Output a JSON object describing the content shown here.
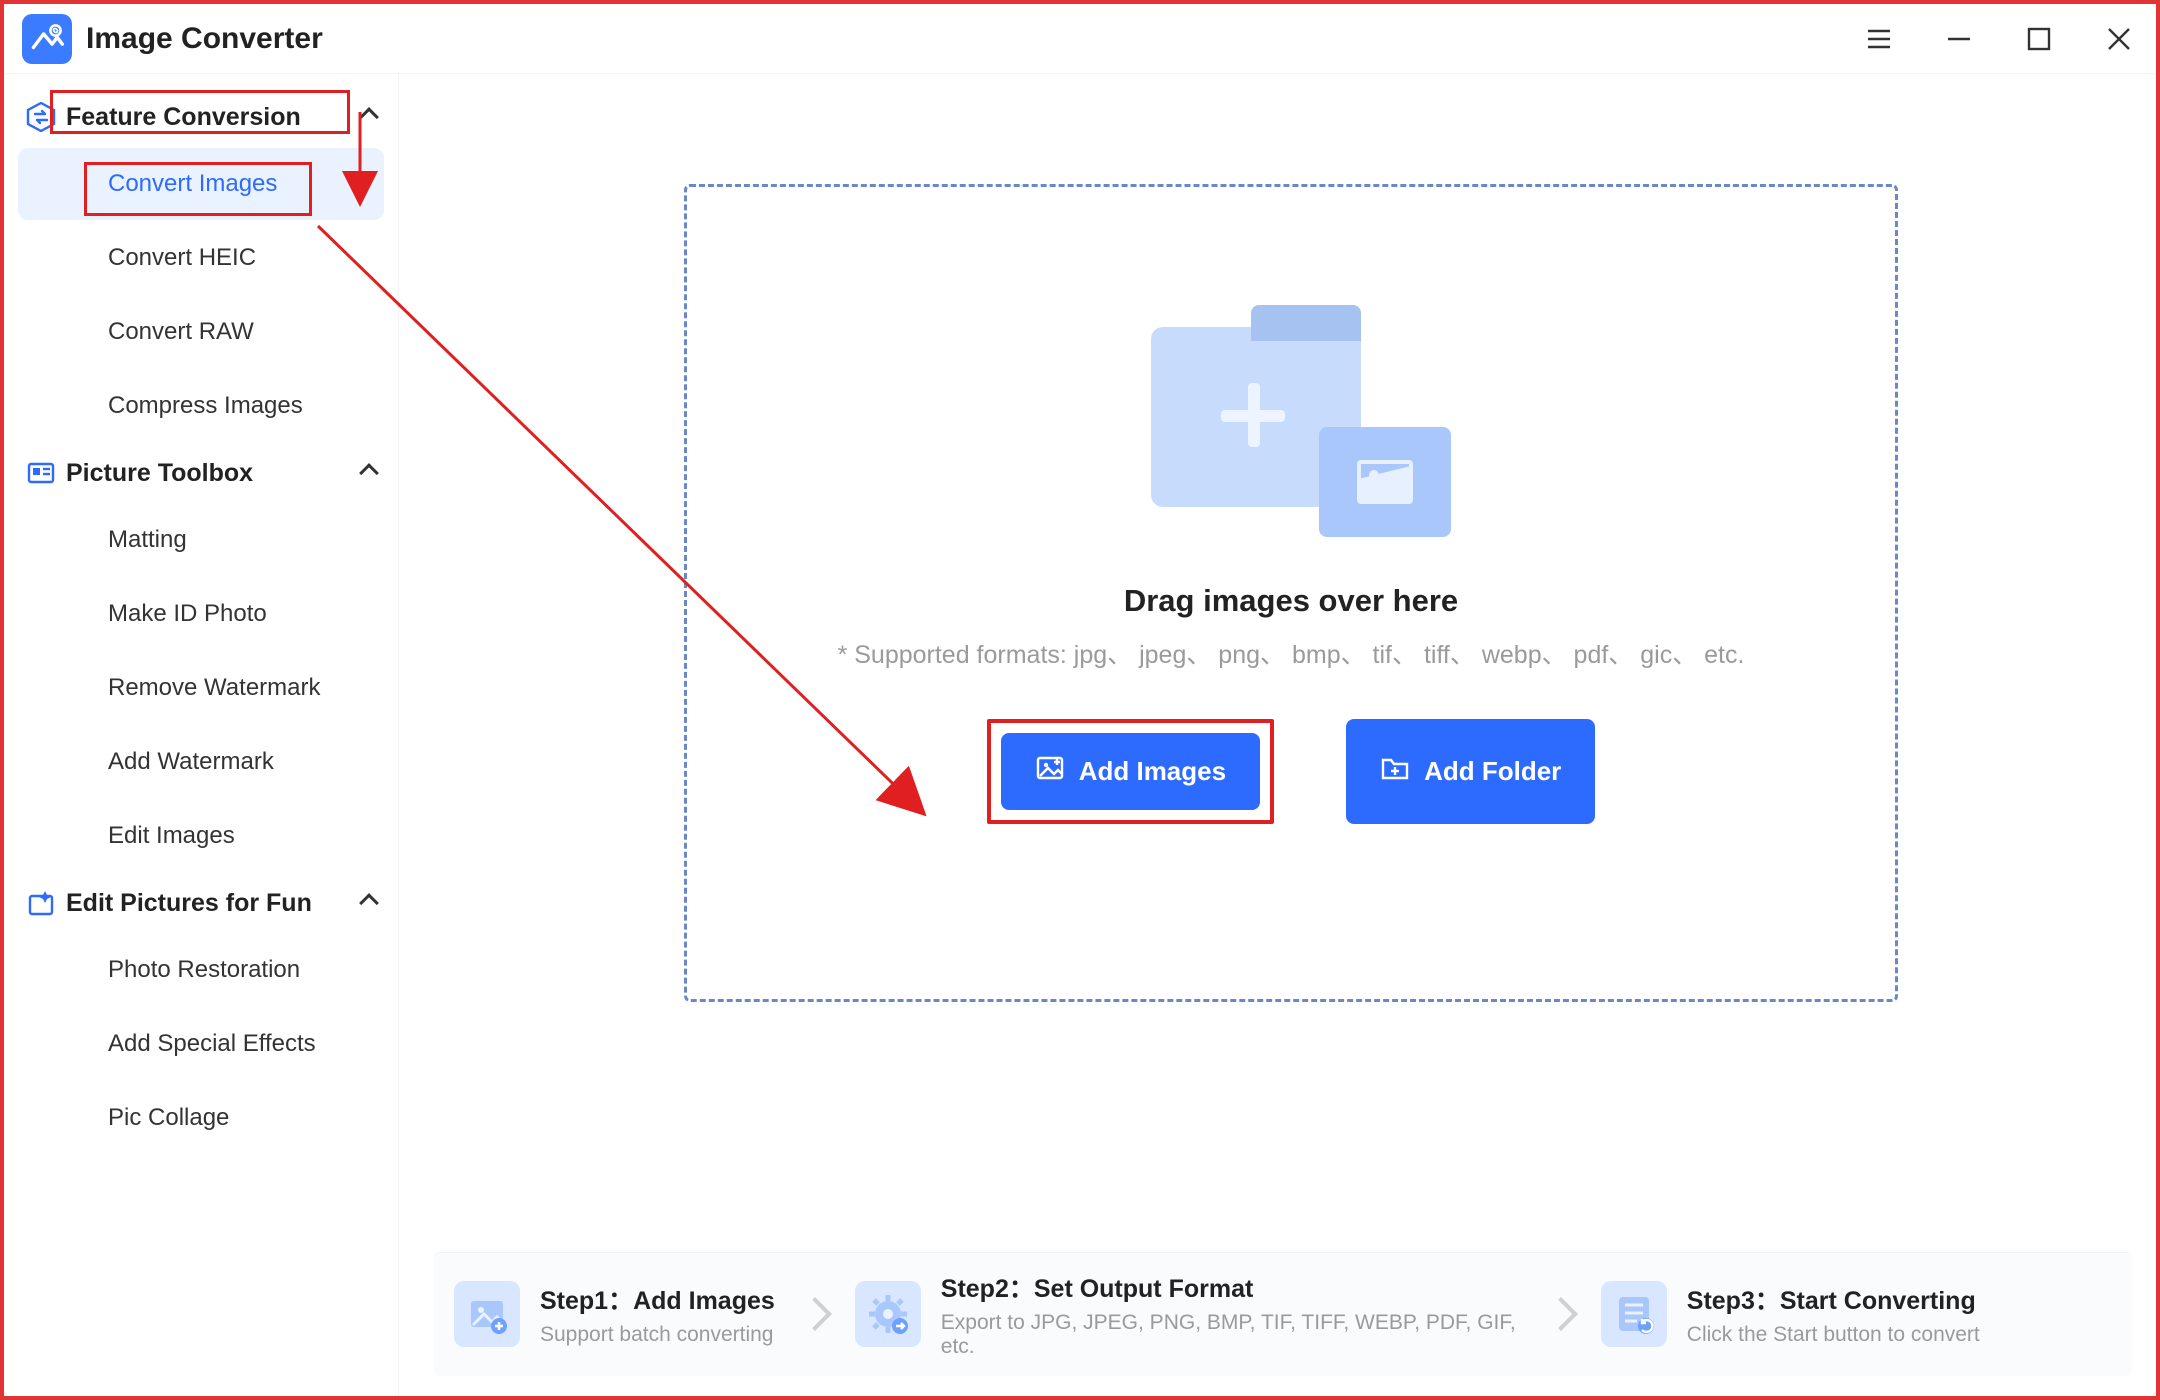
{
  "app": {
    "title": "Image Converter"
  },
  "sidebar": {
    "sections": [
      {
        "title": "Feature Conversion",
        "items": [
          "Convert Images",
          "Convert HEIC",
          "Convert RAW",
          "Compress Images"
        ]
      },
      {
        "title": "Picture Toolbox",
        "items": [
          "Matting",
          "Make ID Photo",
          "Remove Watermark",
          "Add Watermark",
          "Edit Images"
        ]
      },
      {
        "title": "Edit Pictures for Fun",
        "items": [
          "Photo Restoration",
          "Add Special Effects",
          "Pic Collage"
        ]
      }
    ]
  },
  "dropzone": {
    "headline": "Drag images over here",
    "subtext": "* Supported formats: jpg、 jpeg、 png、 bmp、 tif、 tiff、 webp、 pdf、 gic、 etc.",
    "add_images": "Add Images",
    "add_folder": "Add Folder"
  },
  "steps": {
    "s1": {
      "title": "Step1：Add Images",
      "sub": "Support batch converting"
    },
    "s2": {
      "title": "Step2：Set Output Format",
      "sub": "Export to JPG, JPEG, PNG, BMP, TIF, TIFF, WEBP, PDF, GIF, etc."
    },
    "s3": {
      "title": "Step3：Start Converting",
      "sub": "Click the Start button to convert"
    }
  }
}
